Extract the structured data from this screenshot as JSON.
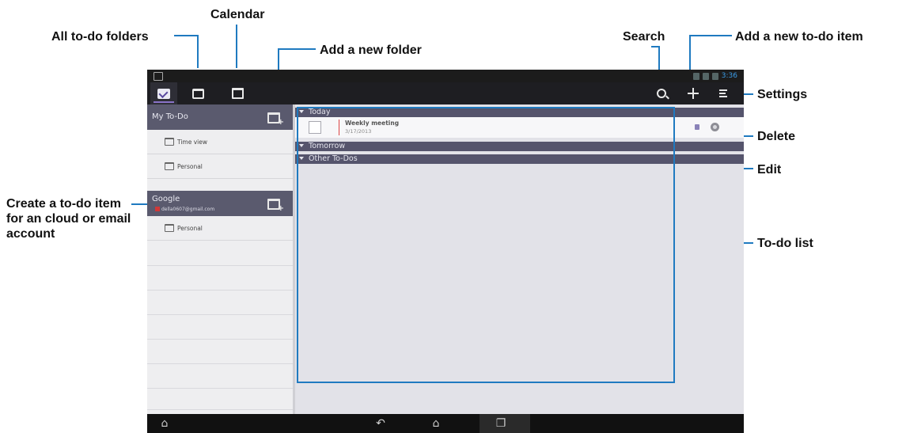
{
  "callouts": {
    "all_folders": "All to-do folders",
    "calendar": "Calendar",
    "add_folder": "Add a new folder",
    "search": "Search",
    "add_item": "Add a new to-do item",
    "settings": "Settings",
    "delete": "Delete",
    "edit": "Edit",
    "create_account_item": "Create a to-do item for an cloud or email account",
    "todo_list": "To-do list"
  },
  "status_bar": {
    "time": "3:36"
  },
  "sidebar": {
    "groups": [
      {
        "label": "My To-Do",
        "items": [
          "Time view",
          "Personal"
        ]
      },
      {
        "label": "Google",
        "account": "della0607@gmail.com",
        "items": [
          "Personal"
        ]
      }
    ]
  },
  "main": {
    "sections": [
      {
        "label": "Today",
        "tasks": [
          {
            "title": "Weekly meeting",
            "date": "3/17/2013"
          }
        ]
      },
      {
        "label": "Tomorrow"
      },
      {
        "label": "Other To-Dos"
      }
    ]
  },
  "colors": {
    "accent": "#1f7ac0",
    "section_header": "#55546c",
    "sidebar_header": "#5a5a6e",
    "action_bar": "#1e1e22"
  },
  "icons": {
    "tab_todo": "checkbox-icon",
    "tab_folders": "folder-icon",
    "tab_calendar": "calendar-icon",
    "search": "search-icon",
    "add": "plus-icon",
    "settings": "menu-icon",
    "add_folder": "add-folder-icon",
    "edit": "edit-icon",
    "delete": "delete-icon"
  }
}
